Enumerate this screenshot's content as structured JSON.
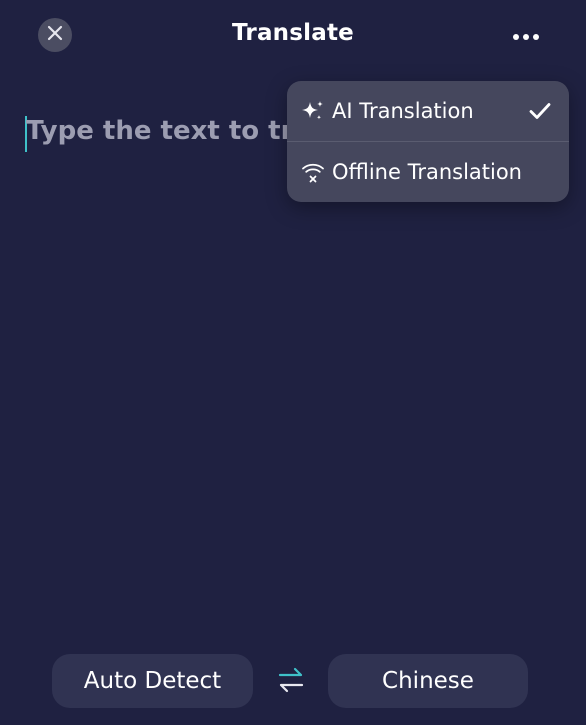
{
  "header": {
    "title": "Translate",
    "close_icon": "close-icon",
    "more_icon": "more-horizontal-icon"
  },
  "editor": {
    "placeholder": "Type the text to translate"
  },
  "menu": {
    "items": [
      {
        "label": "AI Translation",
        "icon": "sparkles-icon",
        "selected": true
      },
      {
        "label": "Offline Translation",
        "icon": "wifi-off-icon",
        "selected": false
      }
    ]
  },
  "languages": {
    "source": "Auto Detect",
    "target": "Chinese",
    "swap_icon": "swap-arrows-icon"
  },
  "colors": {
    "background": "#1f2141",
    "menu_background": "#45475d",
    "language_button": "#303352",
    "accent": "#3fc1c9",
    "placeholder": "#9c9db1"
  }
}
